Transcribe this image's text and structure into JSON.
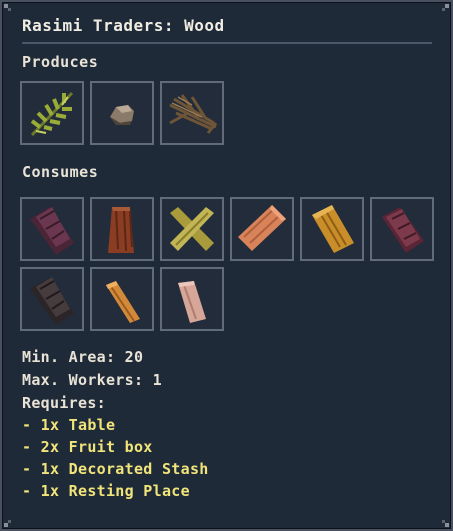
{
  "tooltip": {
    "title": "Rasimi Traders: Wood",
    "produces_label": "Produces",
    "produces": [
      {
        "icon": "herb-branch-icon"
      },
      {
        "icon": "stone-chunk-icon"
      },
      {
        "icon": "twig-bundle-icon"
      }
    ],
    "consumes_label": "Consumes",
    "consumes": [
      {
        "icon": "purple-log-icon",
        "color": "#5a2f43"
      },
      {
        "icon": "mahogany-plank-icon",
        "color": "#8a3d23"
      },
      {
        "icon": "crossed-yellow-planks-icon",
        "color": "#b5a846"
      },
      {
        "icon": "light-orange-plank-icon",
        "color": "#d8835a"
      },
      {
        "icon": "golden-plank-icon",
        "color": "#c98e2a"
      },
      {
        "icon": "dark-red-log-icon",
        "color": "#6e3142"
      },
      {
        "icon": "dark-grey-log-icon",
        "color": "#3a3234"
      },
      {
        "icon": "orange-slat-icon",
        "color": "#d28a3a"
      },
      {
        "icon": "pale-pink-slat-icon",
        "color": "#d6a698"
      }
    ],
    "min_area": "Min. Area: 20",
    "max_workers": "Max. Workers: 1",
    "requires_label": "Requires:",
    "requirements": [
      "- 1x Table",
      "- 2x Fruit box",
      "- 1x Decorated Stash",
      "- 1x Resting Place"
    ],
    "colors": {
      "background": "#1f2a38",
      "border": "#4a5160",
      "slot_border": "#626b79",
      "text": "#e8e3d6",
      "requirement_text": "#f0e47a"
    }
  }
}
